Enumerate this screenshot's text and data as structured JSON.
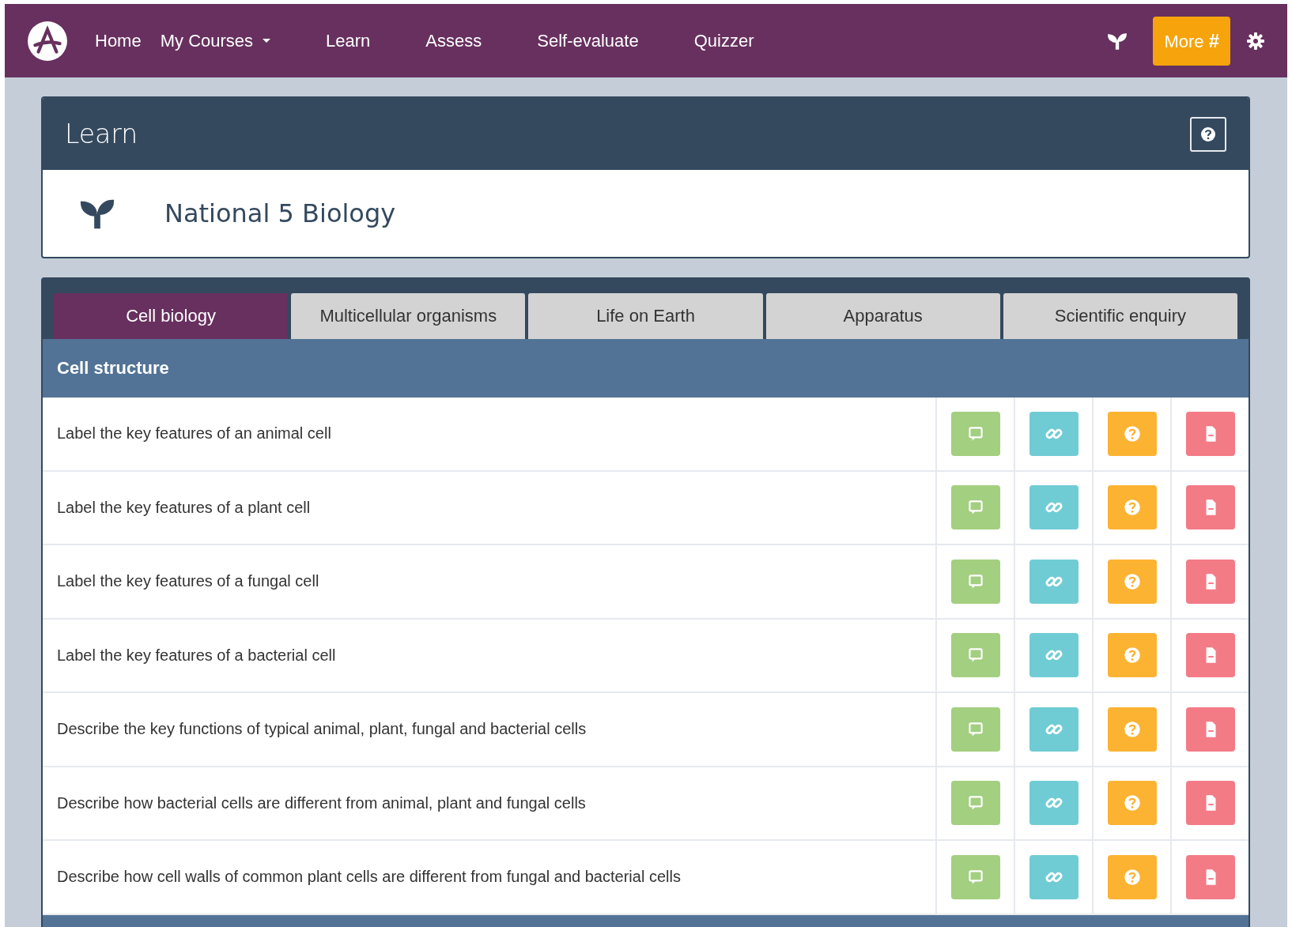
{
  "navbar": {
    "items": [
      {
        "label": "Home",
        "dropdown": false
      },
      {
        "label": "My Courses",
        "dropdown": true
      },
      {
        "label": "Learn",
        "dropdown": false
      },
      {
        "label": "Assess",
        "dropdown": false
      },
      {
        "label": "Self-evaluate",
        "dropdown": false
      },
      {
        "label": "Quizzer",
        "dropdown": false
      }
    ],
    "more_button": {
      "label": "More",
      "icon": "#"
    }
  },
  "header": {
    "title": "Learn",
    "course": "National 5 Biology"
  },
  "tabs": [
    {
      "label": "Cell biology",
      "selected": true
    },
    {
      "label": "Multicellular organisms",
      "selected": false
    },
    {
      "label": "Life on Earth",
      "selected": false
    },
    {
      "label": "Apparatus",
      "selected": false
    },
    {
      "label": "Scientific enquiry",
      "selected": false
    }
  ],
  "section": {
    "title": "Cell structure"
  },
  "row_actions": [
    {
      "kind": "comment",
      "color": "#a3cf80"
    },
    {
      "kind": "link",
      "color": "#70ccd4"
    },
    {
      "kind": "question",
      "color": "#fcb332"
    },
    {
      "kind": "document",
      "color": "#f37b86"
    }
  ],
  "rows": [
    {
      "text": "Label the key features of an animal cell"
    },
    {
      "text": "Label the key features of a plant cell"
    },
    {
      "text": "Label the key features of a fungal cell"
    },
    {
      "text": "Label the key features of a bacterial cell"
    },
    {
      "text": "Describe the key functions of typical animal, plant, fungal and bacterial cells"
    },
    {
      "text": "Describe how bacterial cells are different from animal, plant and fungal cells"
    },
    {
      "text": "Describe how cell walls of common plant cells are different from fungal and bacterial cells"
    }
  ]
}
